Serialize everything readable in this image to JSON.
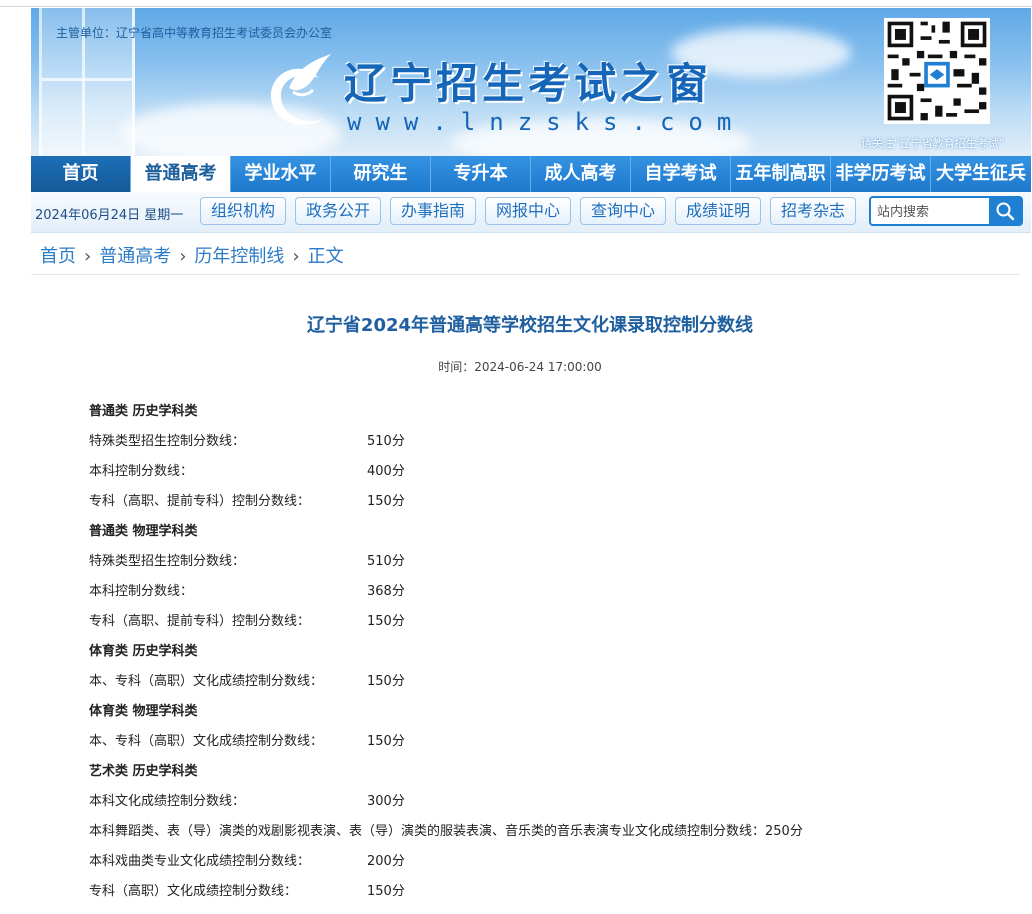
{
  "header": {
    "sponsor": "主管单位：辽宁省高中等教育招生考试委员会办公室",
    "title": "辽宁招生考试之窗",
    "domain": "www.lnzsks.com",
    "qr_caption": "请关注“辽宁省教育招生考试”"
  },
  "nav": {
    "items": [
      {
        "label": "首页"
      },
      {
        "label": "普通高考"
      },
      {
        "label": "学业水平"
      },
      {
        "label": "研究生"
      },
      {
        "label": "专升本"
      },
      {
        "label": "成人高考"
      },
      {
        "label": "自学考试"
      },
      {
        "label": "五年制高职"
      },
      {
        "label": "非学历考试"
      },
      {
        "label": "大学生征兵"
      }
    ]
  },
  "subbar": {
    "date": "2024年06月24日 星期一",
    "links": [
      "组织机构",
      "政务公开",
      "办事指南",
      "网报中心",
      "查询中心",
      "成绩证明",
      "招考杂志"
    ],
    "search_placeholder": "站内搜索"
  },
  "breadcrumb": [
    "首页",
    "普通高考",
    "历年控制线",
    "正文"
  ],
  "article": {
    "title": "辽宁省2024年普通高等学校招生文化课录取控制分数线",
    "time": "时间：2024-06-24 17:00:00",
    "lines": [
      {
        "type": "heading",
        "label": "普通类  历史学科类",
        "value": ""
      },
      {
        "type": "row",
        "label": "特殊类型招生控制分数线：",
        "value": "510分"
      },
      {
        "type": "row",
        "label": "本科控制分数线：",
        "value": "400分"
      },
      {
        "type": "row",
        "label": "专科（高职、提前专科）控制分数线：",
        "value": "150分"
      },
      {
        "type": "heading",
        "label": "普通类  物理学科类",
        "value": ""
      },
      {
        "type": "row",
        "label": "特殊类型招生控制分数线：",
        "value": "510分"
      },
      {
        "type": "row",
        "label": "本科控制分数线：",
        "value": "368分"
      },
      {
        "type": "row",
        "label": "专科（高职、提前专科）控制分数线：",
        "value": "150分"
      },
      {
        "type": "heading",
        "label": "体育类  历史学科类",
        "value": ""
      },
      {
        "type": "row",
        "label": "本、专科（高职）文化成绩控制分数线：",
        "value": "150分"
      },
      {
        "type": "heading",
        "label": "体育类  物理学科类",
        "value": ""
      },
      {
        "type": "row",
        "label": "本、专科（高职）文化成绩控制分数线：",
        "value": "150分"
      },
      {
        "type": "heading",
        "label": "艺术类  历史学科类",
        "value": ""
      },
      {
        "type": "row",
        "label": "本科文化成绩控制分数线：",
        "value": "300分"
      },
      {
        "type": "full",
        "label": "本科舞蹈类、表（导）演类的戏剧影视表演、表（导）演类的服装表演、音乐类的音乐表演专业文化成绩控制分数线：250分",
        "value": ""
      },
      {
        "type": "row",
        "label": "本科戏曲类专业文化成绩控制分数线：",
        "value": "200分"
      },
      {
        "type": "row",
        "label": "专科（高职）文化成绩控制分数线：",
        "value": "150分"
      }
    ]
  }
}
